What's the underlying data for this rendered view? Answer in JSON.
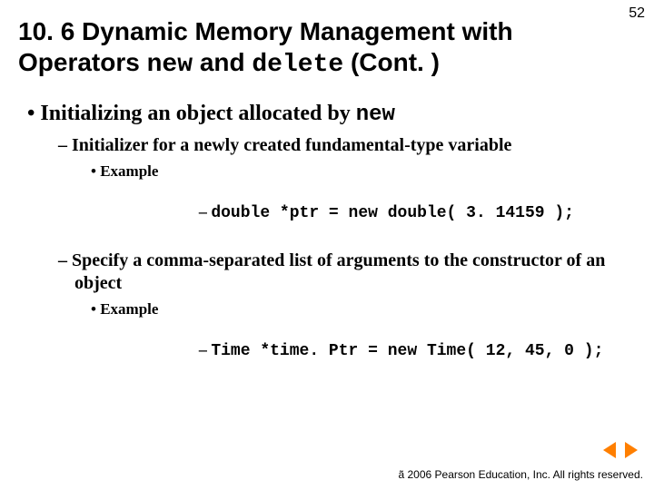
{
  "page_number": "52",
  "title": {
    "part1": "10. 6 Dynamic Memory Management with Operators ",
    "kw1": "new",
    "part2": " and ",
    "kw2": "delete",
    "part3": " (Cont. )"
  },
  "bullets": {
    "l1": {
      "text": "Initializing an object allocated by ",
      "kw": "new"
    },
    "l2a": "Initializer for a newly created fundamental-type variable",
    "example_label": "Example",
    "code1": "double *ptr = new double( 3. 14159 );",
    "l2b": "Specify a comma-separated list of arguments to the constructor of an object",
    "code2": "Time *time. Ptr = new Time( 12, 45, 0 );"
  },
  "footer": "ã 2006 Pearson Education, Inc.  All rights reserved."
}
